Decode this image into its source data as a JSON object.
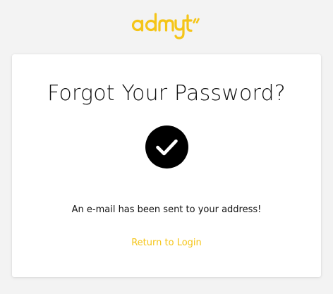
{
  "brand": {
    "logo_text": "admyt",
    "accent_color": "#f5c518"
  },
  "card": {
    "title": "Forgot Your Password?",
    "status_icon": "checkmark-circle-icon",
    "message": "An e-mail has been sent to your address!",
    "return_link_label": "Return to Login"
  }
}
